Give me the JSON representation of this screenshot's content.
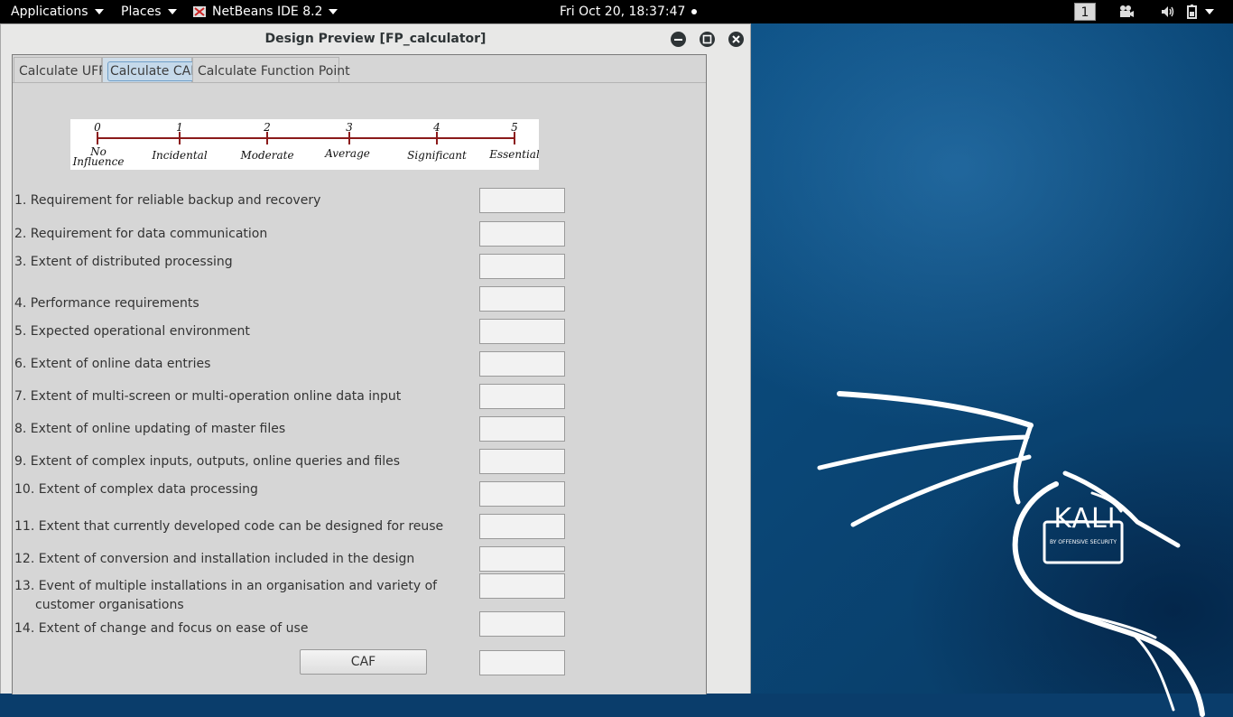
{
  "topbar": {
    "applications": "Applications",
    "places": "Places",
    "netbeans": "NetBeans IDE 8.2",
    "clock": "Fri Oct 20, 18:37:47",
    "workspace": "1"
  },
  "window": {
    "title": "Design Preview [FP_calculator]"
  },
  "tabs": [
    {
      "label": "Calculate UFP",
      "active": false
    },
    {
      "label": "Calculate CAF",
      "active": true
    },
    {
      "label": "Calculate Function Point",
      "active": false
    }
  ],
  "scale": {
    "ticks": [
      "0",
      "1",
      "2",
      "3",
      "4",
      "5"
    ],
    "labels": [
      "No",
      "Influence",
      "Incidental",
      "Moderate",
      "Average",
      "Significant",
      "Essential"
    ]
  },
  "questions": [
    "1. Requirement for reliable backup and recovery",
    "2. Requirement  for data communication",
    "3. Extent of distributed processing",
    "4. Performance requirements",
    "5. Expected operational environment",
    "6. Extent of online data entries",
    "7. Extent of multi-screen or multi-operation online data input",
    "8. Extent of online updating of master files",
    "9. Extent of complex inputs, outputs, online queries and files",
    "10. Extent of complex data processing",
    "11. Extent that currently developed code can be designed for reuse",
    "12. Extent of conversion and installation included in the design",
    "13. Event of multiple installations in an organisation and variety of",
    "customer organisations",
    "14. Extent of change and focus on ease of use"
  ],
  "caf_button": "CAF",
  "wallpaper": {
    "brand": "KALI",
    "tagline": "BY OFFENSIVE SECURITY"
  },
  "colors": {
    "desktop": "#0b4d80",
    "scale_line": "#8b1a1a"
  }
}
